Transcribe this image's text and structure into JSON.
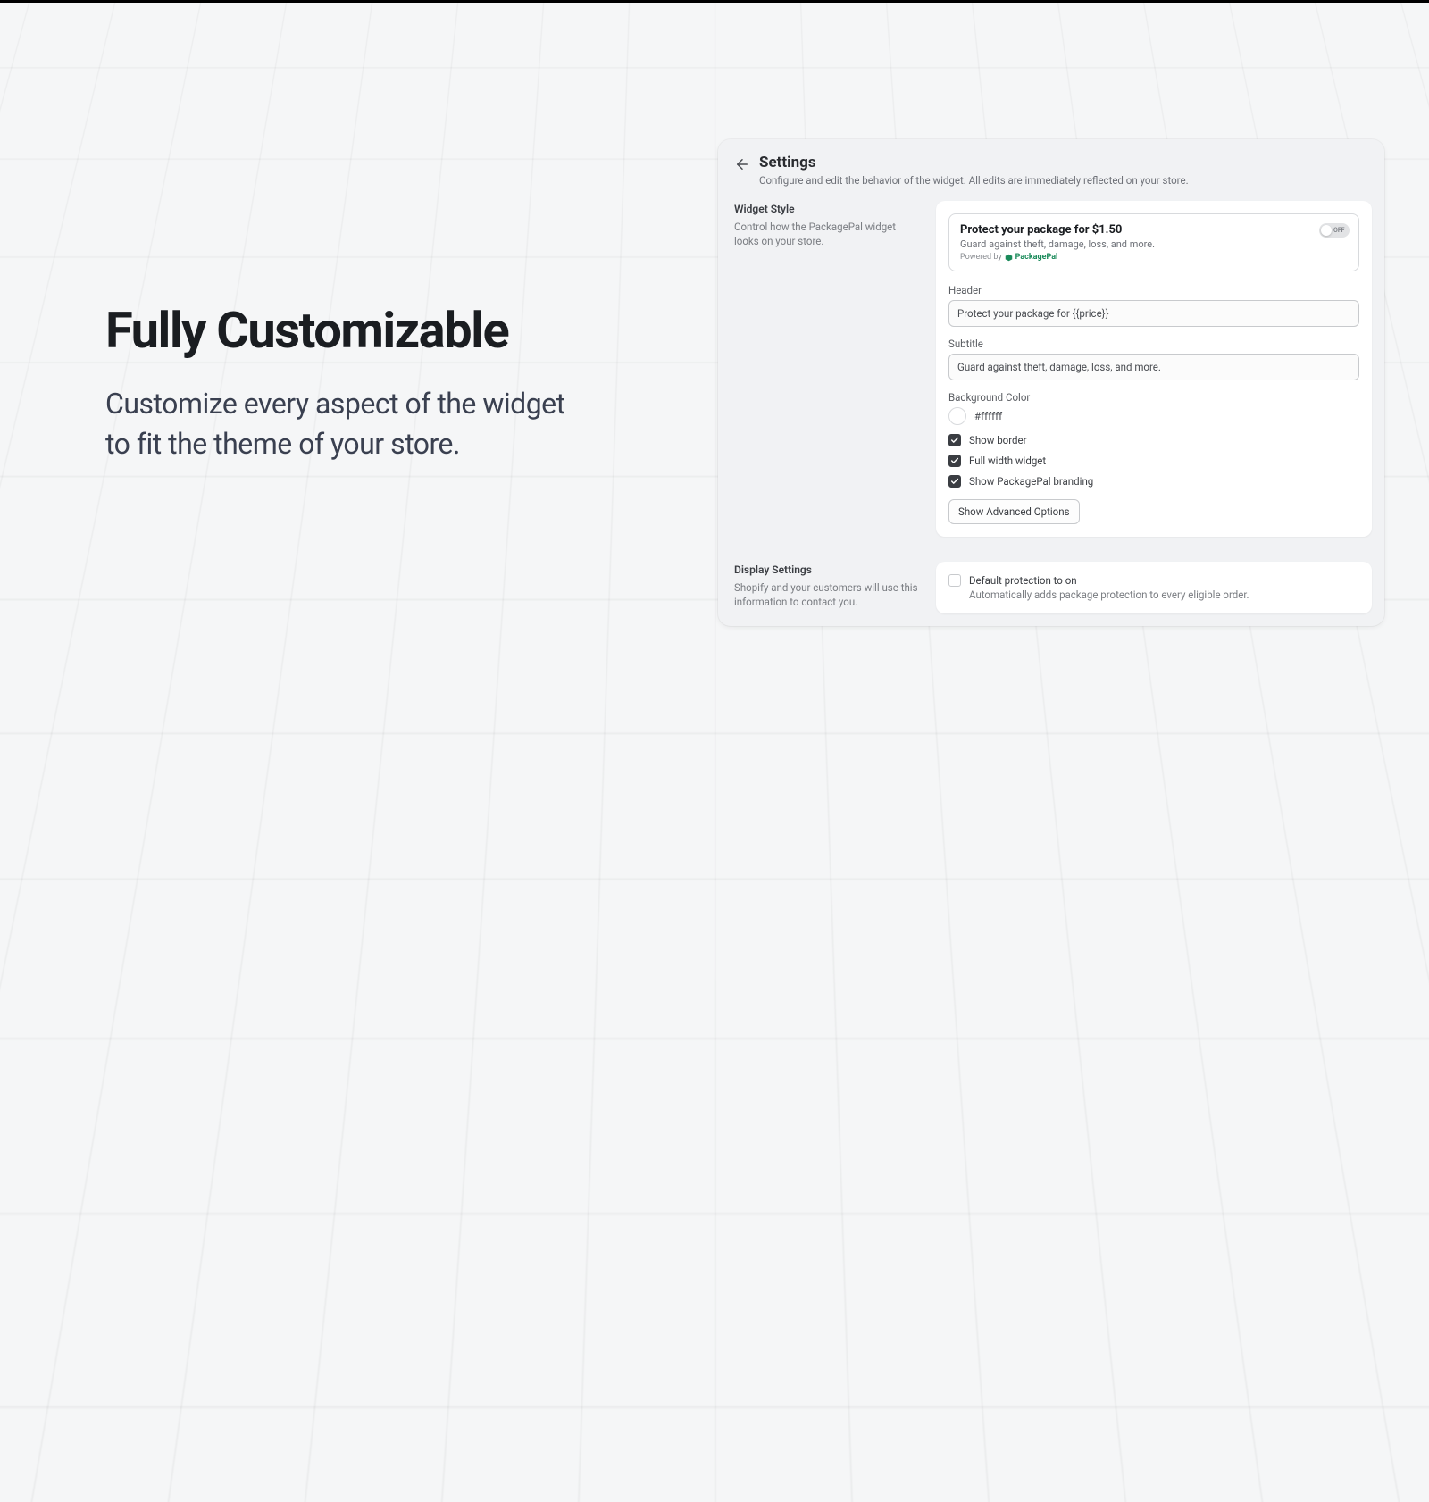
{
  "hero": {
    "title": "Fully Customizable",
    "subtitle": "Customize every aspect of the widget to fit the theme of your store."
  },
  "panel": {
    "title": "Settings",
    "subtitle": "Configure and edit the behavior of the widget. All edits are immediately reflected on your store."
  },
  "widgetStyle": {
    "label": "Widget Style",
    "desc": "Control how the PackagePal widget looks on your store.",
    "preview": {
      "title": "Protect your package for $1.50",
      "subtitle": "Guard against theft, damage, loss, and more.",
      "poweredBy": "Powered by",
      "brandName": "PackagePal",
      "toggleState": "OFF"
    },
    "fields": {
      "headerLabel": "Header",
      "headerValue": "Protect your package for {{price}}",
      "subtitleLabel": "Subtitle",
      "subtitleValue": "Guard against theft, damage, loss, and more.",
      "bgColorLabel": "Background Color",
      "bgColorValue": "#ffffff",
      "showBorder": "Show border",
      "fullWidth": "Full width widget",
      "showBranding": "Show PackagePal branding",
      "advancedBtn": "Show Advanced Options"
    }
  },
  "displaySettings": {
    "label": "Display Settings",
    "desc": "Shopify and your customers will use this information to contact you.",
    "defaultProtection": "Default protection to on",
    "defaultProtectionDesc": "Automatically adds package protection to every eligible order."
  }
}
